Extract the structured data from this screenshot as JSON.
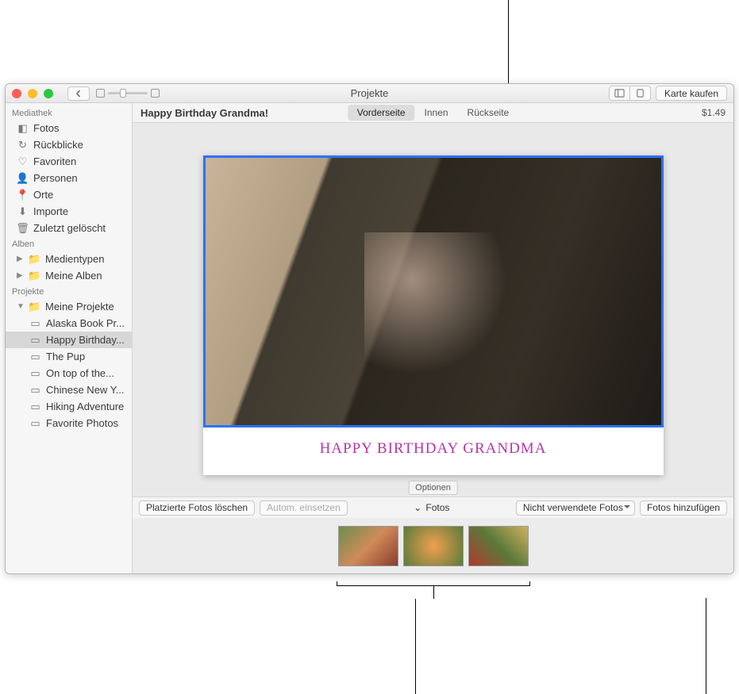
{
  "window_title": "Projekte",
  "buy_button": "Karte kaufen",
  "sidebar": {
    "sections": [
      {
        "title": "Mediathek",
        "items": [
          {
            "icon": "photos",
            "label": "Fotos"
          },
          {
            "icon": "clock",
            "label": "Rückblicke"
          },
          {
            "icon": "heart",
            "label": "Favoriten"
          },
          {
            "icon": "person",
            "label": "Personen"
          },
          {
            "icon": "pin",
            "label": "Orte"
          },
          {
            "icon": "download",
            "label": "Importe"
          },
          {
            "icon": "trash",
            "label": "Zuletzt gelöscht"
          }
        ]
      },
      {
        "title": "Alben",
        "items": [
          {
            "icon": "folder",
            "label": "Medientypen",
            "disclose": true
          },
          {
            "icon": "folder",
            "label": "Meine Alben",
            "disclose": true
          }
        ]
      },
      {
        "title": "Projekte",
        "items": [
          {
            "icon": "folder",
            "label": "Meine Projekte",
            "disclose": true,
            "open": true,
            "children": [
              {
                "icon": "book",
                "label": "Alaska Book Pr..."
              },
              {
                "icon": "card",
                "label": "Happy Birthday...",
                "selected": true
              },
              {
                "icon": "card",
                "label": "The Pup"
              },
              {
                "icon": "card",
                "label": "On top of the..."
              },
              {
                "icon": "card",
                "label": "Chinese New Y..."
              },
              {
                "icon": "book",
                "label": "Hiking Adventure"
              },
              {
                "icon": "slides",
                "label": "Favorite Photos"
              }
            ]
          }
        ]
      }
    ]
  },
  "project_title": "Happy Birthday Grandma!",
  "tabs": {
    "front": "Vorderseite",
    "inside": "Innen",
    "back": "Rückseite"
  },
  "price": "$1.49",
  "card_caption": "HAPPY BIRTHDAY GRANDMA",
  "options_label": "Optionen",
  "bottombar": {
    "clear_placed": "Platzierte Fotos löschen",
    "auto_fill": "Autom. einsetzen",
    "fotos": "Fotos",
    "unused_filter": "Nicht verwendete Fotos",
    "add_photos": "Fotos hinzufügen"
  }
}
